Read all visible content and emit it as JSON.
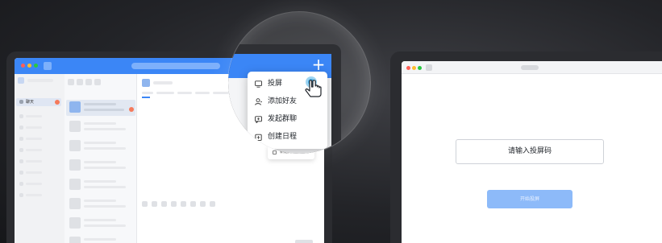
{
  "left_app": {
    "nav_active_label": "聊天"
  },
  "popup_menu": {
    "items": [
      {
        "label": "投屏",
        "icon": "screen-icon"
      },
      {
        "label": "添加好友",
        "icon": "add-friend-icon"
      },
      {
        "label": "发起群聊",
        "icon": "group-chat-icon"
      },
      {
        "label": "创建日程",
        "icon": "calendar-icon"
      }
    ],
    "extra_item_label": "新建文档"
  },
  "right_app": {
    "code_placeholder": "请输入投屏码",
    "start_button_label": "开始投屏"
  },
  "colors": {
    "accent": "#3b86f6",
    "button_disabled": "#8dbaf9",
    "badge": "#f57a5b"
  }
}
